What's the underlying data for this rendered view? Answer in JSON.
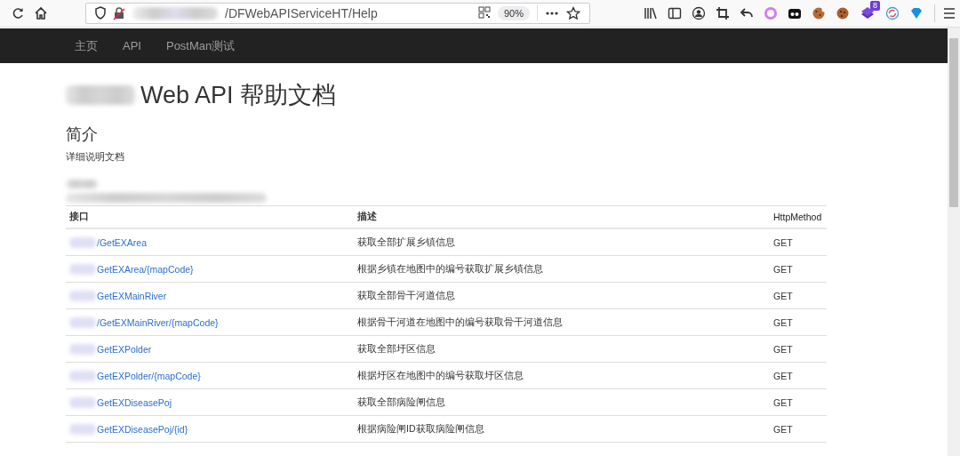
{
  "browser": {
    "url": "/DFWebAPIServiceHT/Help",
    "zoom": "90%",
    "extension_badge": "8"
  },
  "nav": {
    "items": [
      {
        "label": "主页"
      },
      {
        "label": "API"
      },
      {
        "label": "PostMan测试"
      }
    ]
  },
  "title": "Web API 帮助文档",
  "intro": {
    "heading": "简介",
    "text": "详细说明文档"
  },
  "table": {
    "columns": [
      "接口",
      "描述",
      "HttpMethod"
    ],
    "rows": [
      {
        "api": "/GetEXArea",
        "description": "获取全部扩展乡镇信息",
        "method": "GET"
      },
      {
        "api": "GetEXArea/{mapCode}",
        "description": "根据乡镇在地图中的编号获取扩展乡镇信息",
        "method": "GET"
      },
      {
        "api": "GetEXMainRiver",
        "description": "获取全部骨干河道信息",
        "method": "GET"
      },
      {
        "api": "/GetEXMainRiver/{mapCode}",
        "description": "根据骨干河道在地图中的编号获取骨干河道信息",
        "method": "GET"
      },
      {
        "api": "GetEXPolder",
        "description": "获取全部圩区信息",
        "method": "GET"
      },
      {
        "api": "GetEXPolder/{mapCode}",
        "description": "根据圩区在地图中的编号获取圩区信息",
        "method": "GET"
      },
      {
        "api": "GetEXDiseasePoj",
        "description": "获取全部病险闸信息",
        "method": "GET"
      },
      {
        "api": "GetEXDiseasePoj/{id}",
        "description": "根据病险闸ID获取病险闸信息",
        "method": "GET"
      }
    ]
  }
}
